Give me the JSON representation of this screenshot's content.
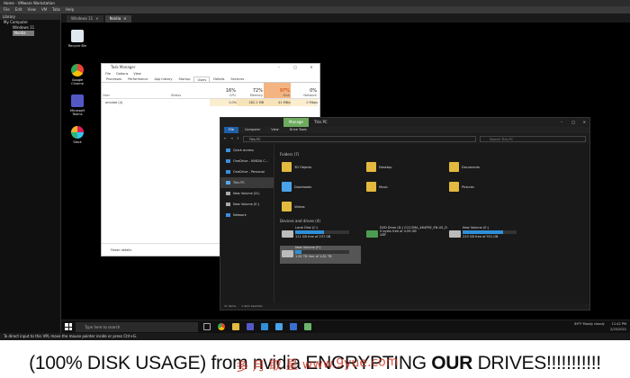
{
  "vmware": {
    "title": "Home - VMware Workstation",
    "menu": [
      "File",
      "Edit",
      "View",
      "VM",
      "Tabs",
      "Help"
    ],
    "library_label": "Library",
    "tree": [
      {
        "label": "My Computer",
        "selected": false
      },
      {
        "label": "Windows 11",
        "selected": false
      },
      {
        "label": "Nvidia",
        "selected": true
      }
    ],
    "tabs": [
      {
        "label": "Windows 11",
        "active": false
      },
      {
        "label": "Nvidia",
        "active": true
      }
    ],
    "status_hint": "To direct input to this VM, move the mouse pointer inside or press Ctrl+G."
  },
  "desktop_icons": [
    {
      "label": "Recycle Bin",
      "icon": "recycle-bin-icon",
      "color": "#dfe7ef"
    },
    {
      "label": "Google Chrome",
      "icon": "chrome-icon",
      "color": "#e94335"
    },
    {
      "label": "Microsoft Teams",
      "icon": "teams-icon",
      "color": "#5458c7"
    },
    {
      "label": "Slack",
      "icon": "slack-icon",
      "color": "#f1b534"
    }
  ],
  "task_manager": {
    "title": "Task Manager",
    "menu": [
      "File",
      "Options",
      "View"
    ],
    "tabs": [
      "Processes",
      "Performance",
      "App history",
      "Startup",
      "Users",
      "Details",
      "Services"
    ],
    "active_tab": "Users",
    "headers": [
      {
        "label": "User",
        "pct": ""
      },
      {
        "label": "Status",
        "pct": ""
      },
      {
        "label": "CPU",
        "pct": "16%"
      },
      {
        "label": "Memory",
        "pct": "72%"
      },
      {
        "label": "Disk",
        "pct": "97%"
      },
      {
        "label": "Network",
        "pct": "0%"
      }
    ],
    "row": {
      "user": "acrobat (4)",
      "status": "",
      "cpu": "1.0%",
      "memory": "282.1 MB",
      "disk": "41 MB/s",
      "network": "0 Mbps"
    },
    "footer": "Fewer details",
    "colors": {
      "disk_high": "#f4b482",
      "mem_med": "#f8e3b8"
    }
  },
  "explorer": {
    "title": "This PC",
    "ribbon": [
      "File",
      "Computer",
      "View"
    ],
    "ribbon_tool": "Manage",
    "ribbon_tool_sub": "Drive Tools",
    "ribbon_tool_color": "#6dab5e",
    "address": "This PC",
    "search_placeholder": "Search This PC",
    "nav": [
      {
        "label": "Quick access",
        "icon": "star-icon",
        "color": "#3a8fe0",
        "selected": false
      },
      {
        "label": "OneDrive - NVIDIA C...",
        "icon": "cloud-icon",
        "color": "#3a8fe0",
        "selected": false
      },
      {
        "label": "OneDrive - Personal",
        "icon": "cloud-icon",
        "color": "#3a8fe0",
        "selected": false
      },
      {
        "label": "This PC",
        "icon": "pc-icon",
        "color": "#55a8f0",
        "selected": true
      },
      {
        "label": "New Volume (D:)",
        "icon": "drive-icon",
        "color": "#aaaaaa",
        "selected": false
      },
      {
        "label": "New Volume (E:)",
        "icon": "drive-icon",
        "color": "#aaaaaa",
        "selected": false
      },
      {
        "label": "Network",
        "icon": "network-icon",
        "color": "#3a8fe0",
        "selected": false
      }
    ],
    "folders_heading": "Folders (7)",
    "folders": [
      "3D Objects",
      "Desktop",
      "Documents",
      "Downloads",
      "Music",
      "Pictures",
      "Videos"
    ],
    "drives_heading": "Devices and drives (4)",
    "drives": [
      {
        "label": "Local Disk (C:)",
        "free": "111 GB free of 237 GB",
        "used_fraction": 0.53,
        "selected": false
      },
      {
        "label": "DVD Drive (D:) CCCOMA_X64FRE_EN-US_DV9",
        "free": "0 bytes free of 4.59 GB",
        "sub": "UDF",
        "used_fraction": null,
        "selected": false
      },
      {
        "label": "New Volume (E:)",
        "free": "229 GB free of 931 GB",
        "used_fraction": 0.75,
        "selected": false
      },
      {
        "label": "New Volume (F:)",
        "free": "1.61 TB free of 1.81 TB",
        "used_fraction": 0.11,
        "selected": true
      }
    ],
    "status": [
      "11 items",
      "1 item selected"
    ]
  },
  "taskbar": {
    "search_placeholder": "Type here to search",
    "apps": [
      "task-view-icon",
      "chrome-icon",
      "file-explorer-icon",
      "teams-icon",
      "store-icon",
      "photos-icon",
      "calendar-icon",
      "task-manager-icon"
    ],
    "weather": "89°F  Mostly cloudy",
    "time": "11:42 PM",
    "date": "2/25/2022"
  },
  "caption": {
    "part1": "(100% DISK USAGE) from nvidia ENCRYPTING ",
    "bold": "OUR",
    "part2": " DRIVES!!!!!!!!!!!"
  },
  "watermark": "多 月 取 星  www.9yue.com"
}
